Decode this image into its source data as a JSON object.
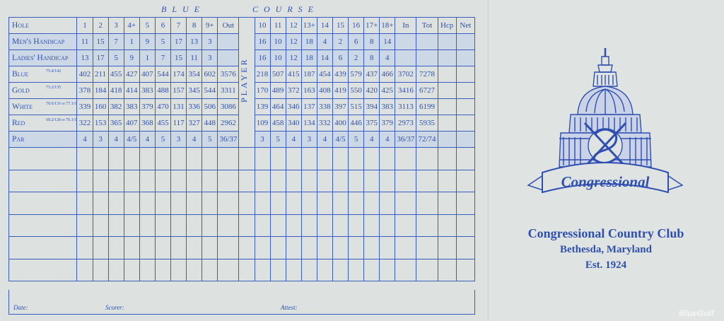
{
  "course": {
    "word1": "BLUE",
    "word2": "COURSE"
  },
  "columns": [
    "Hole",
    "1",
    "2",
    "3",
    "4+",
    "5",
    "6",
    "7",
    "8",
    "9+",
    "Out",
    "PLAYER",
    "10",
    "11",
    "12",
    "13+",
    "14",
    "15",
    "16",
    "17+",
    "18+",
    "In",
    "Tot",
    "Hcp",
    "Net"
  ],
  "rows": [
    {
      "label": "Men's Handicap",
      "values": [
        "11",
        "15",
        "7",
        "1",
        "9",
        "5",
        "17",
        "13",
        "3",
        "",
        "",
        "16",
        "10",
        "12",
        "18",
        "4",
        "2",
        "6",
        "8",
        "14",
        "",
        "",
        "",
        ""
      ]
    },
    {
      "label": "Ladies' Handicap",
      "values": [
        "13",
        "17",
        "5",
        "9",
        "1",
        "7",
        "15",
        "11",
        "3",
        "",
        "",
        "16",
        "10",
        "12",
        "18",
        "14",
        "6",
        "2",
        "8",
        "4",
        "",
        "",
        "",
        ""
      ]
    },
    {
      "label": "Blue",
      "rating": "75.4/142",
      "values": [
        "402",
        "211",
        "455",
        "427",
        "407",
        "544",
        "174",
        "354",
        "602",
        "3576",
        "",
        "218",
        "507",
        "415",
        "187",
        "454",
        "439",
        "579",
        "437",
        "466",
        "3702",
        "7278",
        "",
        ""
      ]
    },
    {
      "label": "Gold",
      "rating": "73.2/135",
      "values": [
        "378",
        "184",
        "418",
        "414",
        "383",
        "488",
        "157",
        "345",
        "544",
        "3311",
        "",
        "170",
        "489",
        "372",
        "163",
        "408",
        "419",
        "550",
        "420",
        "425",
        "3416",
        "6727",
        "",
        ""
      ]
    },
    {
      "label": "White",
      "rating": "70.6/131-m 77.1/134-w",
      "values": [
        "339",
        "160",
        "382",
        "383",
        "379",
        "470",
        "131",
        "336",
        "506",
        "3086",
        "",
        "139",
        "464",
        "346",
        "137",
        "338",
        "397",
        "515",
        "394",
        "383",
        "3113",
        "6199",
        "",
        ""
      ]
    },
    {
      "label": "Red",
      "rating": "69.2/126-m 76.1/129-w",
      "values": [
        "322",
        "153",
        "365",
        "407",
        "368",
        "455",
        "117",
        "327",
        "448",
        "2962",
        "",
        "109",
        "458",
        "340",
        "134",
        "332",
        "400",
        "446",
        "375",
        "379",
        "2973",
        "5935",
        "",
        ""
      ]
    },
    {
      "label": "Par",
      "values": [
        "4",
        "3",
        "4",
        "4/5",
        "4",
        "5",
        "3",
        "4",
        "5",
        "36/37",
        "",
        "3",
        "5",
        "4",
        "3",
        "4",
        "4/5",
        "5",
        "4",
        "4",
        "36/37",
        "72/74",
        "",
        ""
      ]
    }
  ],
  "footer": {
    "date": "Date:",
    "scorer": "Scorer:",
    "attest": "Attest:"
  },
  "club": {
    "logo_text": "Congressional",
    "name": "Congressional Country Club",
    "location": "Bethesda, Maryland",
    "established": "Est. 1924"
  },
  "watermark": "BlueGolf",
  "colors": {
    "ink": "#2f4fb0",
    "paper": "#dde2e1",
    "shade": "#cdd8e6"
  }
}
